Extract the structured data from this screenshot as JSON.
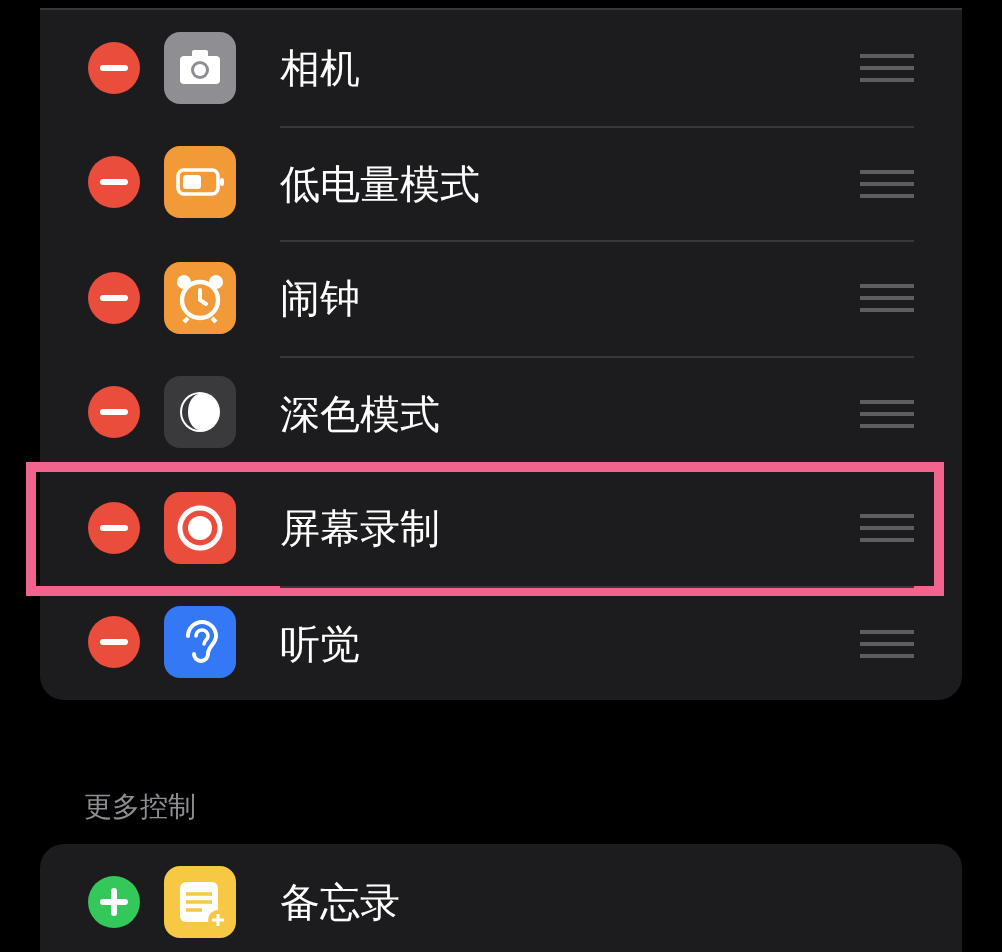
{
  "sections": [
    {
      "kind": "included",
      "items": [
        {
          "label": "相机",
          "kind": "camera",
          "highlighted": false
        },
        {
          "label": "低电量模式",
          "kind": "battery",
          "highlighted": false
        },
        {
          "label": "闹钟",
          "kind": "alarm",
          "highlighted": false
        },
        {
          "label": "深色模式",
          "kind": "dark-mode",
          "highlighted": false
        },
        {
          "label": "屏幕录制",
          "kind": "record",
          "highlighted": true
        },
        {
          "label": "听觉",
          "kind": "hearing",
          "highlighted": false
        }
      ]
    },
    {
      "kind": "more",
      "header": "更多控制",
      "items": [
        {
          "label": "备忘录",
          "kind": "notes",
          "highlighted": false
        }
      ]
    }
  ]
}
